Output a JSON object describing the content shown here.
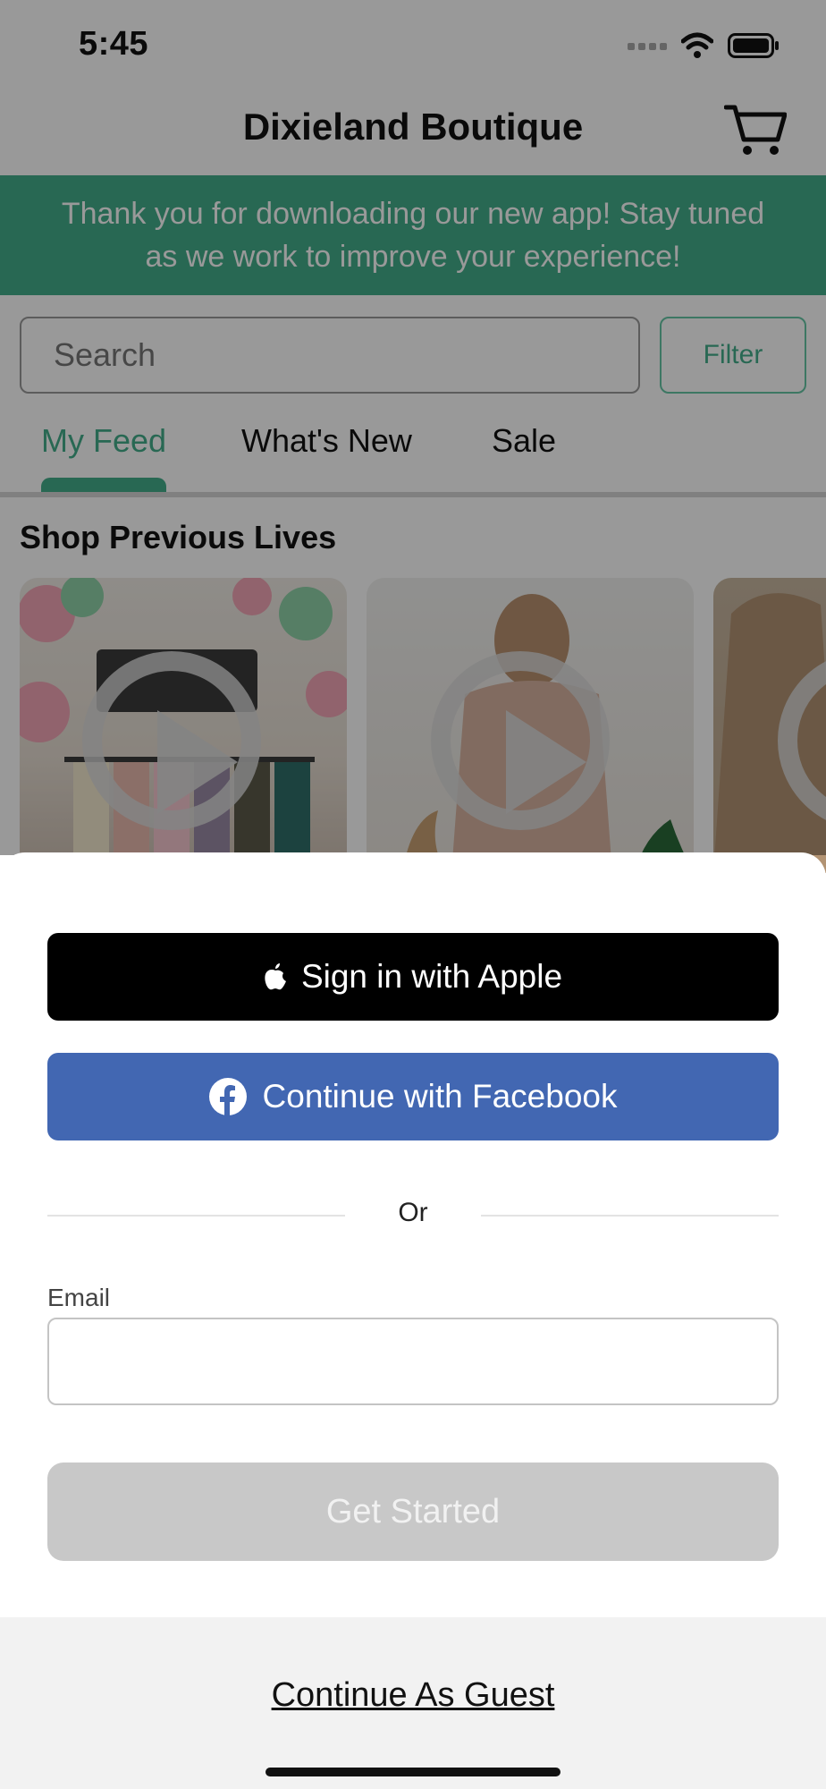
{
  "status_bar": {
    "time": "5:45"
  },
  "header": {
    "title": "Dixieland Boutique",
    "cart_icon": "cart-icon"
  },
  "banner": {
    "line1": "Thank you for downloading our new app! Stay tuned",
    "line2": "as we work to improve your experience!"
  },
  "search": {
    "placeholder": "Search",
    "filter_label": "Filter"
  },
  "tabs": [
    {
      "label": "My Feed",
      "active": true
    },
    {
      "label": "What's New",
      "active": false
    },
    {
      "label": "Sale",
      "active": false
    }
  ],
  "section": {
    "title": "Shop Previous Lives"
  },
  "sheet": {
    "apple_button": "Sign in with Apple",
    "facebook_button": "Continue with Facebook",
    "or_label": "Or",
    "email_label": "Email",
    "email_value": "",
    "get_started": "Get Started",
    "guest_link": "Continue As Guest"
  },
  "colors": {
    "accent": "#43ad8a",
    "facebook": "#4267b2",
    "apple": "#000000",
    "disabled": "#c8c8c8"
  }
}
